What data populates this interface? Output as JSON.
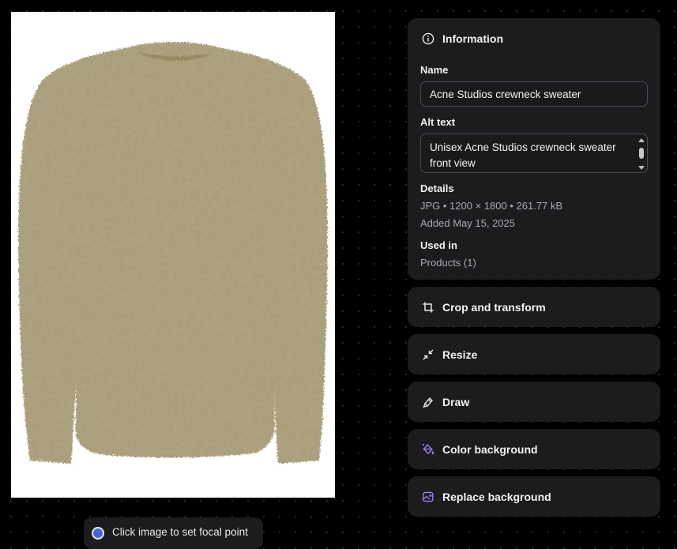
{
  "image": {
    "icon": "sweater-photo"
  },
  "focal": {
    "hint": "Click image to set focal point",
    "dot_color": "#4a62d8"
  },
  "info": {
    "title": "Information",
    "name_label": "Name",
    "name_value": "Acne Studios crewneck sweater",
    "alt_label": "Alt text",
    "alt_value": "Unisex Acne Studios crewneck sweater front view",
    "details_label": "Details",
    "details_line": "JPG • 1200 × 1800 • 261.77 kB",
    "added_line": "Added May 15, 2025",
    "used_label": "Used in",
    "used_value": "Products (1)"
  },
  "actions": {
    "crop": "Crop and transform",
    "resize": "Resize",
    "draw": "Draw",
    "color_bg": "Color background",
    "replace_bg": "Replace background"
  },
  "colors": {
    "ai_accent": "#9b7cf0",
    "panel_bg": "#1c1c1e"
  }
}
